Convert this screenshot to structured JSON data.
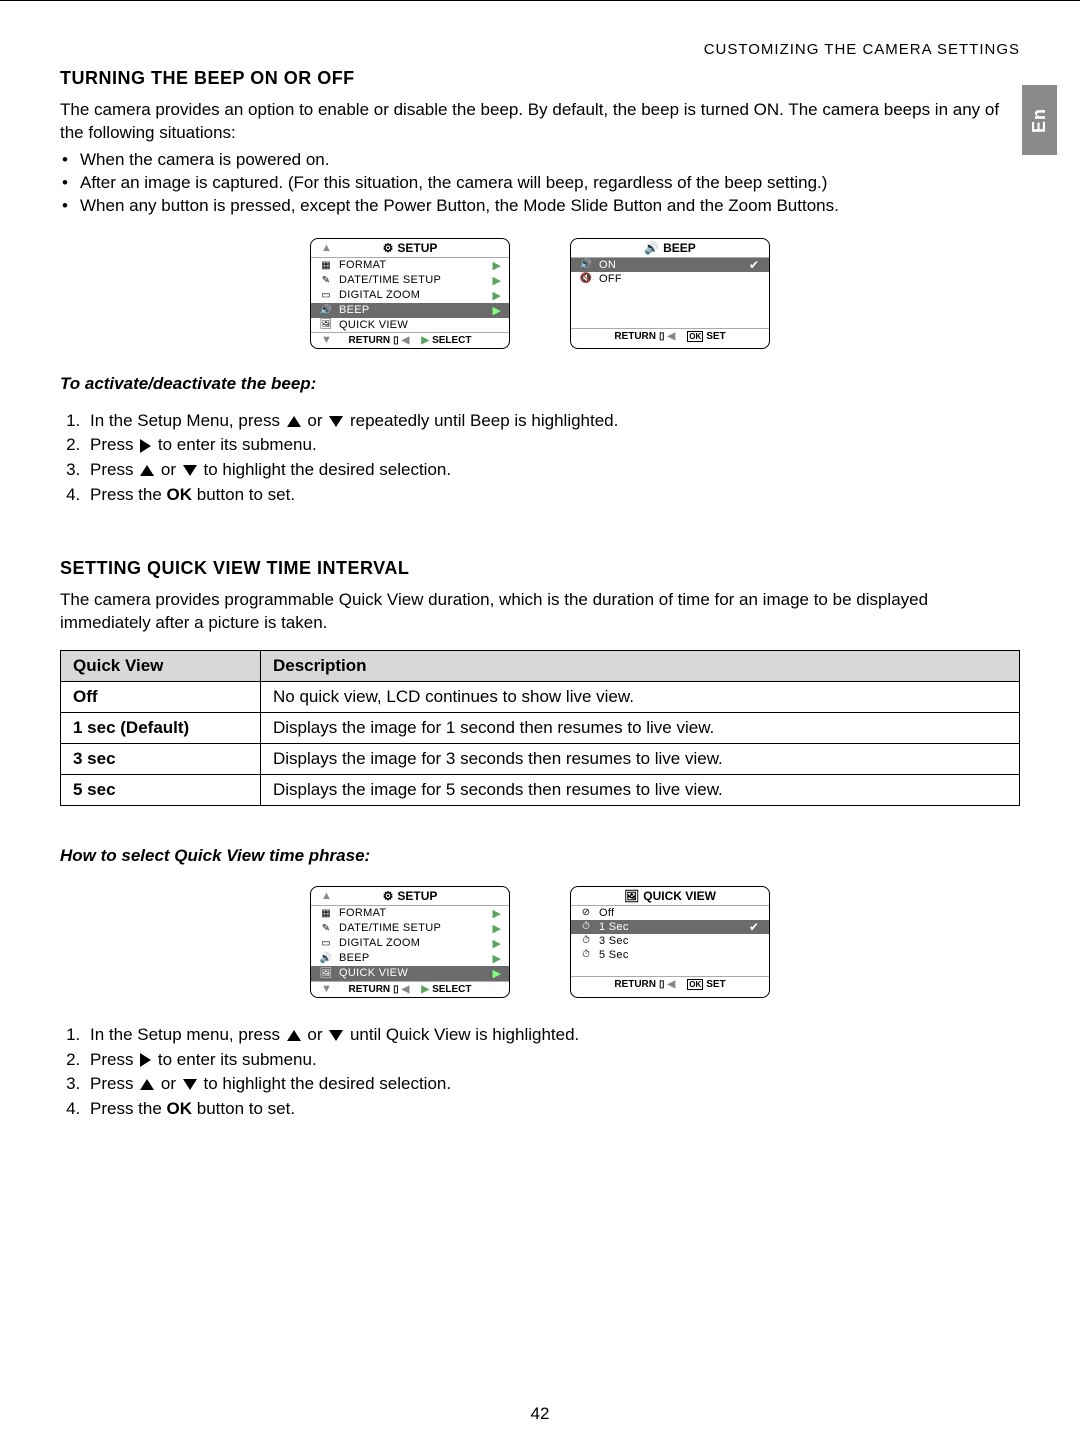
{
  "header": "CUSTOMIZING THE CAMERA SETTINGS",
  "sideTab": "En",
  "pageNum": "42",
  "beep": {
    "title": "TURNING THE BEEP ON OR OFF",
    "intro": "The camera provides an option to enable or disable the beep. By default, the beep is turned ON. The camera beeps in any of the following situations:",
    "bullets": [
      "When the camera is powered on.",
      "After an image is captured. (For this situation, the camera will beep, regardless of the beep setting.)",
      "When any button is pressed, except the Power Button, the Mode Slide Button and the Zoom Buttons."
    ],
    "subhead": "To activate/deactivate the beep:",
    "steps": {
      "s1a": "In the Setup Menu, press ",
      "s1b": " or ",
      "s1c": " repeatedly until Beep is highlighted.",
      "s2a": "Press ",
      "s2b": " to enter its submenu.",
      "s3a": "Press ",
      "s3b": " or ",
      "s3c": " to highlight the desired selection.",
      "s4a": "Press the ",
      "s4b": "OK",
      "s4c": " button to set."
    }
  },
  "qv": {
    "title": "SETTING QUICK VIEW TIME INTERVAL",
    "intro": "The camera provides programmable Quick View duration, which is the duration of time for an image to be displayed immediately after a picture is taken.",
    "table": {
      "h1": "Quick View",
      "h2": "Description",
      "rows": [
        {
          "c1": "Off",
          "c2": "No quick view, LCD continues to show live view."
        },
        {
          "c1": "1 sec (Default)",
          "c2": "Displays the image for 1 second then resumes to live view."
        },
        {
          "c1": "3 sec",
          "c2": "Displays the image for 3 seconds then resumes to live view."
        },
        {
          "c1": "5 sec",
          "c2": "Displays the image for 5 seconds then resumes to live view."
        }
      ]
    },
    "subhead": "How to select Quick View time phrase:",
    "steps": {
      "s1a": "In the Setup menu, press ",
      "s1b": " or ",
      "s1c": " until Quick View is highlighted.",
      "s2a": "Press ",
      "s2b": " to enter its submenu.",
      "s3a": "Press ",
      "s3b": " or ",
      "s3c": " to highlight the desired selection.",
      "s4a": "Press the ",
      "s4b": "OK",
      "s4c": " button to set."
    }
  },
  "lcd": {
    "setup": {
      "title": "SETUP",
      "items": [
        "FORMAT",
        "DATE/TIME SETUP",
        "DIGITAL ZOOM",
        "BEEP",
        "QUICK VIEW"
      ],
      "footReturn": "RETURN",
      "footSelect": "SELECT"
    },
    "beepMenu": {
      "title": "BEEP",
      "on": "ON",
      "off": "OFF",
      "footReturn": "RETURN",
      "footSet": "SET"
    },
    "qvMenu": {
      "title": "QUICK VIEW",
      "items": [
        "Off",
        "1 Sec",
        "3 Sec",
        "5 Sec"
      ],
      "footReturn": "RETURN",
      "footSet": "SET"
    }
  }
}
